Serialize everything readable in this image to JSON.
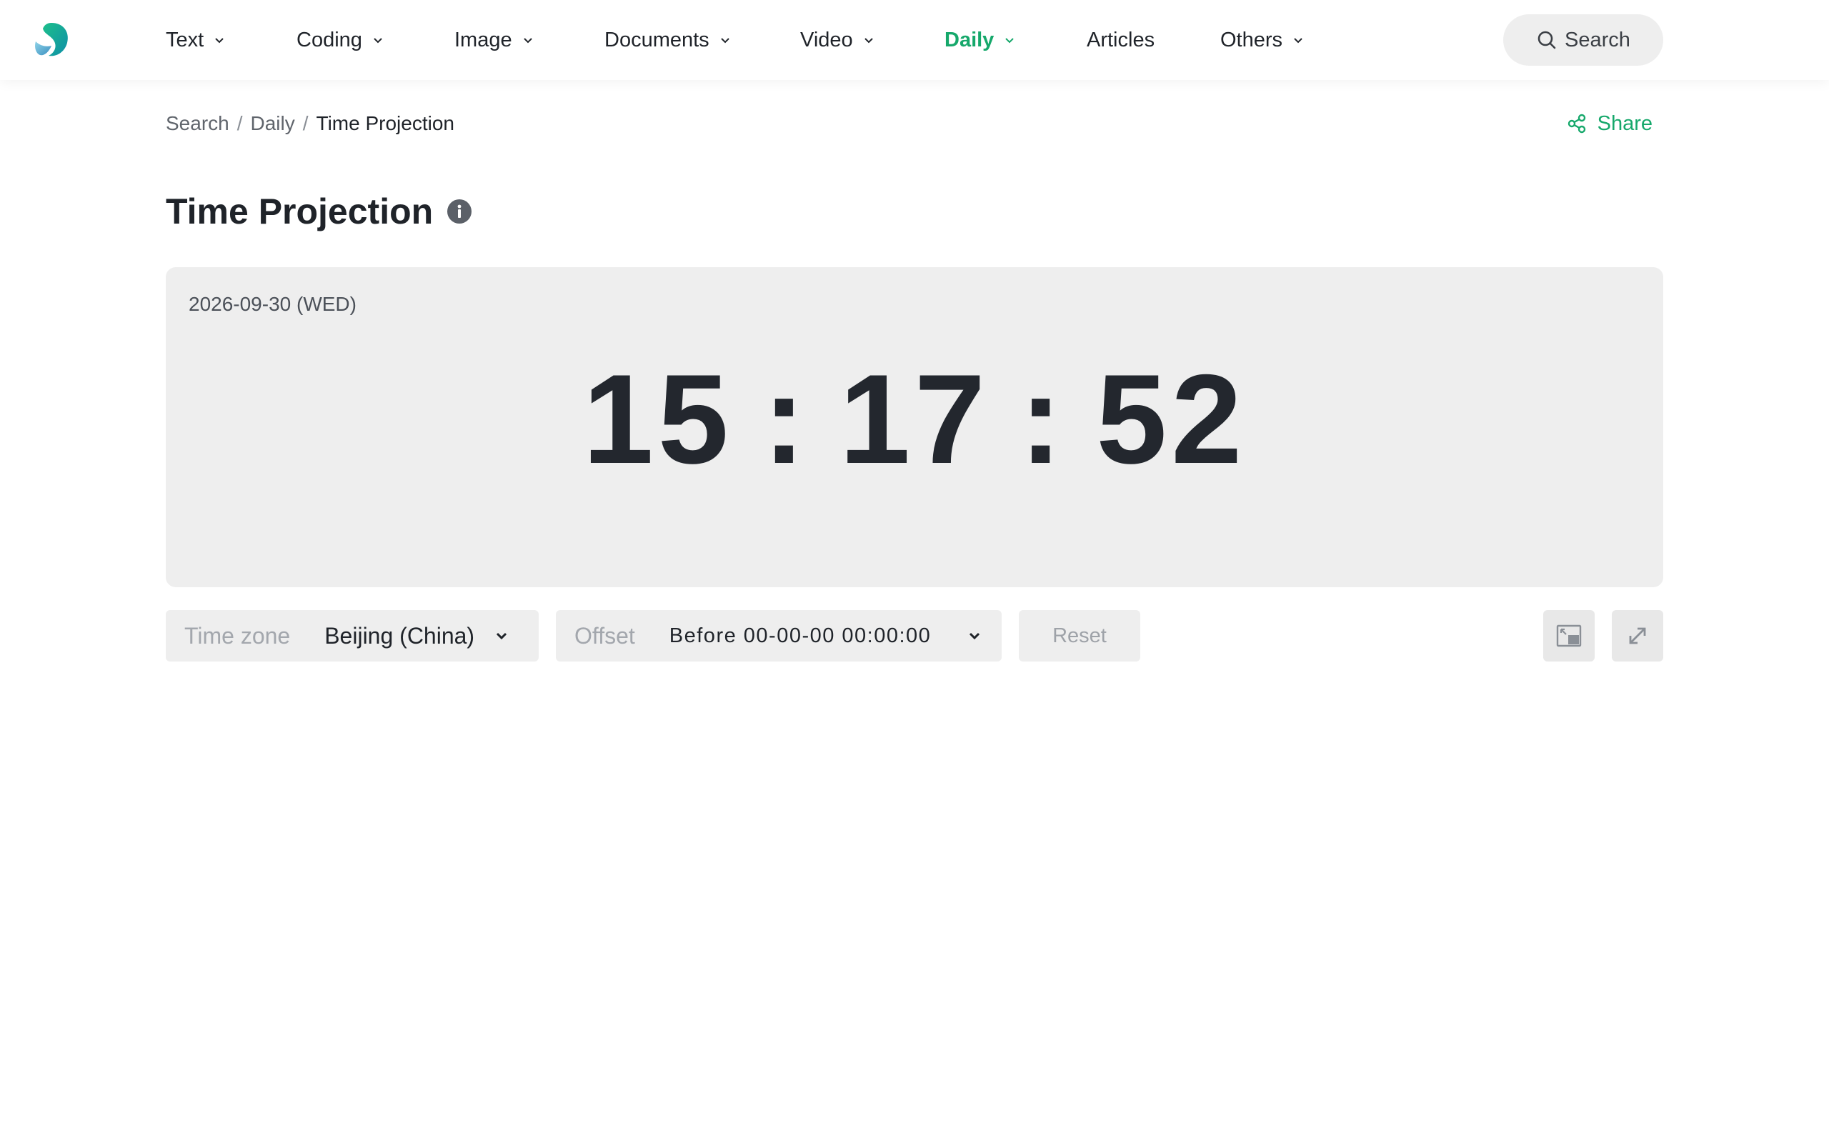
{
  "nav": {
    "items": [
      {
        "label": "Text",
        "dropdown": true
      },
      {
        "label": "Coding",
        "dropdown": true
      },
      {
        "label": "Image",
        "dropdown": true
      },
      {
        "label": "Documents",
        "dropdown": true
      },
      {
        "label": "Video",
        "dropdown": true
      },
      {
        "label": "Daily",
        "dropdown": true,
        "active": true
      },
      {
        "label": "Articles",
        "dropdown": false
      },
      {
        "label": "Others",
        "dropdown": true
      }
    ],
    "search_label": "Search"
  },
  "breadcrumb": {
    "items": [
      "Search",
      "Daily",
      "Time Projection"
    ],
    "separator": "/"
  },
  "share_label": "Share",
  "page": {
    "title": "Time Projection"
  },
  "clock": {
    "date": "2026-09-30 (WED)",
    "hours": "15",
    "minutes": "17",
    "seconds": "52",
    "separator": ":"
  },
  "controls": {
    "timezone_label": "Time zone",
    "timezone_value": "Beijing (China)",
    "offset_label": "Offset",
    "offset_value": "Before 00-00-00 00:00:00",
    "reset_label": "Reset"
  },
  "icons": {
    "logo": "app-logo",
    "search": "search-icon",
    "share": "share-icon",
    "info": "info-icon",
    "pip": "picture-in-picture-icon",
    "fullscreen": "fullscreen-icon"
  },
  "colors": {
    "accent": "#16a86b",
    "panel_bg": "#eeeeee",
    "text_dark": "#23272e"
  }
}
